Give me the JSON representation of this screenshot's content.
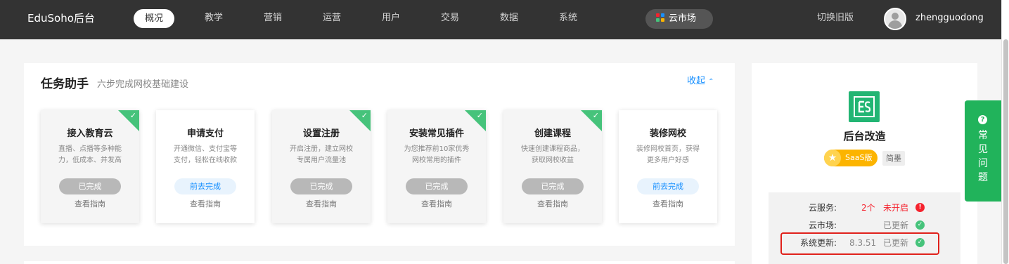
{
  "header": {
    "brand": "EduSoho后台",
    "nav": [
      "概况",
      "教学",
      "营销",
      "运营",
      "用户",
      "交易",
      "数据",
      "系统"
    ],
    "active_nav": "概况",
    "cloud_market": "云市场",
    "switch_old": "切换旧版",
    "username": "zhengguodong"
  },
  "task": {
    "title": "任务助手",
    "subtitle": "六步完成网校基础建设",
    "collapse": "收起",
    "steps": [
      {
        "title": "接入教育云",
        "desc_line1": "直播、点播等多种能",
        "desc_line2": "力，低成本、并发高",
        "button": "已完成",
        "done": true,
        "guide": "查看指南"
      },
      {
        "title": "申请支付",
        "desc_line1": "开通微信、支付宝等",
        "desc_line2": "支付，轻松在线收款",
        "button": "前去完成",
        "done": false,
        "guide": "查看指南"
      },
      {
        "title": "设置注册",
        "desc_line1": "开启注册，建立网校",
        "desc_line2": "专属用户流量池",
        "button": "已完成",
        "done": true,
        "guide": "查看指南"
      },
      {
        "title": "安装常见插件",
        "desc_line1": "为您推荐前10家优秀",
        "desc_line2": "网校常用的插件",
        "button": "已完成",
        "done": true,
        "guide": "查看指南"
      },
      {
        "title": "创建课程",
        "desc_line1": "快速创建课程商品，",
        "desc_line2": "获取网校收益",
        "button": "已完成",
        "done": true,
        "guide": "查看指南"
      },
      {
        "title": "装修网校",
        "desc_line1": "装修网校首页，获得",
        "desc_line2": "更多用户好感",
        "button": "前去完成",
        "done": false,
        "guide": "查看指南"
      }
    ]
  },
  "side": {
    "site_name": "后台改造",
    "saas_badge": "SaaS版",
    "plan": "简墨",
    "cloud_service_label": "云服务:",
    "cloud_service_count": "2个",
    "cloud_service_state": "未开启",
    "cloud_market_label": "云市场:",
    "cloud_market_state": "已更新",
    "system_update_label": "系统更新:",
    "system_version": "8.3.51",
    "system_update_state": "已更新"
  },
  "faq": {
    "icon": "?",
    "chars": [
      "常",
      "见",
      "问",
      "题"
    ]
  },
  "colors": {
    "topbar": "#333333",
    "accent_blue": "#1890ff",
    "success_green": "#46c37b",
    "danger_red": "#f5222d",
    "faq_green": "#21b35b",
    "saas_gold": "#fcb400"
  },
  "icons": {
    "check_corner": "check-icon",
    "chevron_up": "chevron-up-icon",
    "info": "info-icon",
    "check_circle": "check-circle-icon",
    "star": "star-icon",
    "question": "question-icon",
    "apps": "apps-grid-icon",
    "user": "user-avatar-icon"
  }
}
